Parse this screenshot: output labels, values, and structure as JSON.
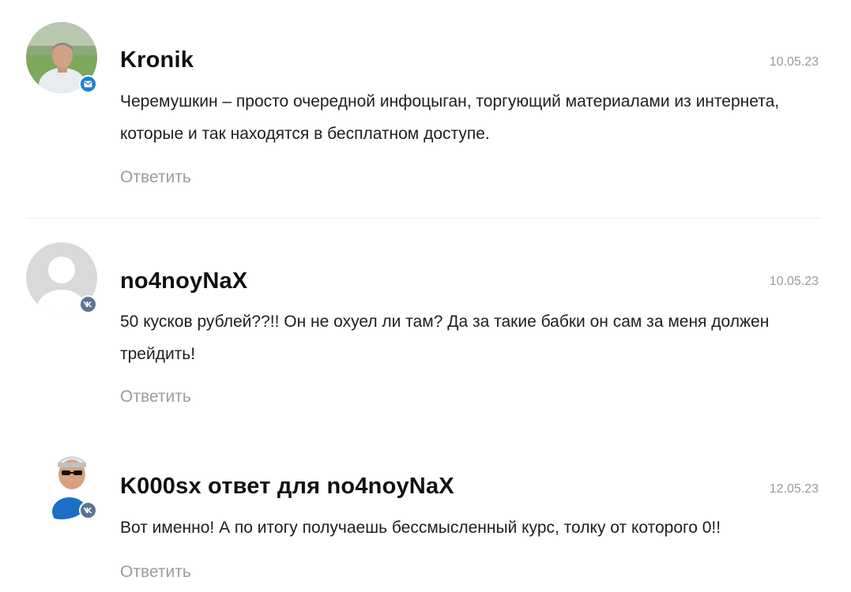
{
  "comments": [
    {
      "author": "Kronik",
      "date": "10.05.23",
      "text": "Черемушкин – просто очередной инфоцыган, торгующий материалами из интернета, которые и так находятся в бесплатном доступе.",
      "reply_label": "Ответить",
      "badge_icon": "mail-icon",
      "avatar": "user-photo"
    },
    {
      "author": "no4noyNaX",
      "date": "10.05.23",
      "text": "50 кусков рублей??!! Он не охуел ли там? Да за такие бабки он сам за меня должен трейдить!",
      "reply_label": "Ответить",
      "badge_icon": "vk-icon",
      "avatar": "default-avatar"
    },
    {
      "author": "K000sx ответ для no4noyNaX",
      "date": "12.05.23",
      "text": "Вот именно! А по итогу получаешь бессмысленный курс, толку от которого 0!!",
      "reply_label": "Ответить",
      "badge_icon": "vk-icon",
      "avatar": "user-photo"
    }
  ],
  "colors": {
    "mail_badge": "#1b7fd4",
    "vk_badge": "#5d7394",
    "muted_text": "#9c9c9c"
  }
}
